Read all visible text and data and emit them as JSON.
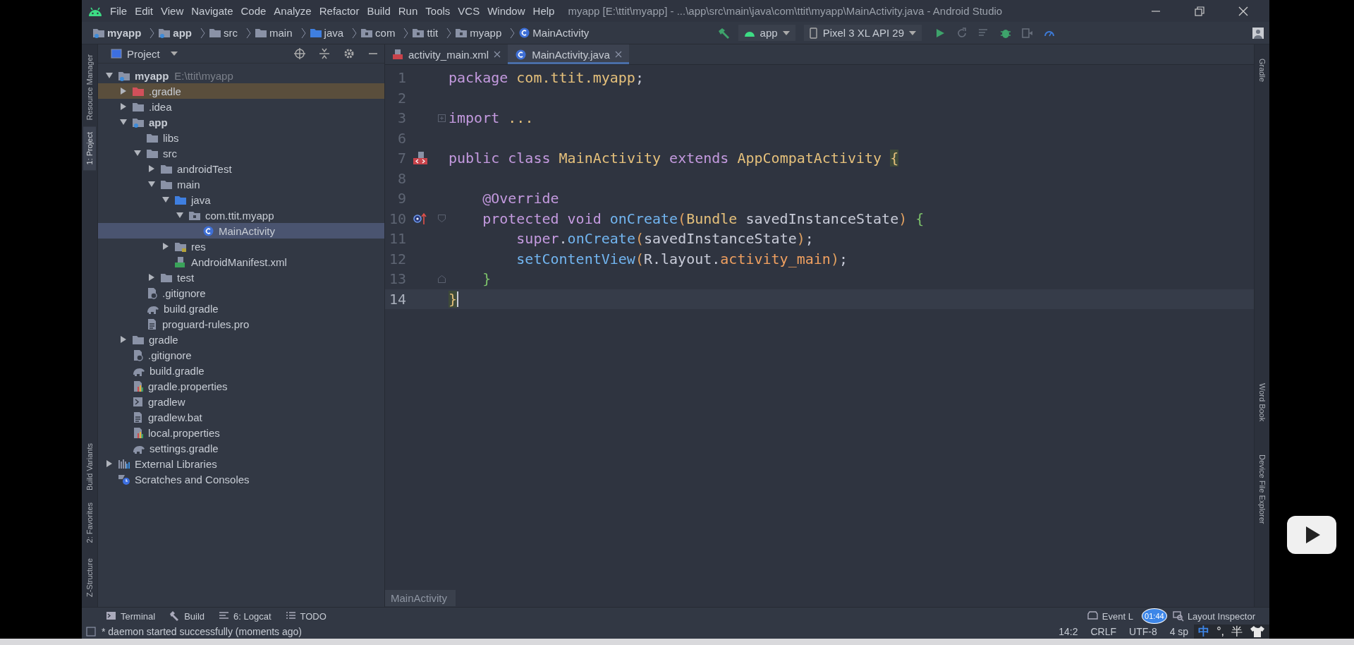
{
  "title_bar": {
    "menu": [
      "File",
      "Edit",
      "View",
      "Navigate",
      "Code",
      "Analyze",
      "Refactor",
      "Build",
      "Run",
      "Tools",
      "VCS",
      "Window",
      "Help"
    ],
    "title": "myapp [E:\\ttit\\myapp] - ...\\app\\src\\main\\java\\com\\ttit\\myapp\\MainActivity.java - Android Studio"
  },
  "nav_bar": {
    "breadcrumbs": [
      {
        "label": "myapp",
        "kind": "module"
      },
      {
        "label": "app",
        "kind": "module"
      },
      {
        "label": "src",
        "kind": "folder"
      },
      {
        "label": "main",
        "kind": "folder"
      },
      {
        "label": "java",
        "kind": "source"
      },
      {
        "label": "com",
        "kind": "package"
      },
      {
        "label": "ttit",
        "kind": "package"
      },
      {
        "label": "myapp",
        "kind": "package"
      },
      {
        "label": "MainActivity",
        "kind": "class"
      }
    ],
    "run_config": "app",
    "device": "Pixel 3 XL API 29"
  },
  "left_strip": [
    {
      "label": "Resource Manager",
      "selected": false
    },
    {
      "label": "1: Project",
      "selected": true
    },
    {
      "label": "Build Variants",
      "selected": false
    },
    {
      "label": "2: Favorites",
      "selected": false
    },
    {
      "label": "Z-Structure",
      "selected": false
    }
  ],
  "right_strip": [
    "Gradle",
    "Word Book",
    "Device File Explorer"
  ],
  "project_panel": {
    "title": "Project",
    "tree": [
      {
        "label": "myapp",
        "path": "E:\\ttit\\myapp",
        "kind": "module",
        "expanded": true,
        "selected": false,
        "marked": false,
        "children": [
          {
            "label": ".gradle",
            "kind": "cache",
            "expanded": false,
            "selected": false,
            "marked": true
          },
          {
            "label": ".idea",
            "kind": "folder",
            "expanded": false,
            "selected": false,
            "marked": false
          },
          {
            "label": "app",
            "kind": "module",
            "expanded": true,
            "selected": false,
            "marked": false,
            "children": [
              {
                "label": "libs",
                "kind": "folder",
                "selected": false,
                "marked": false
              },
              {
                "label": "src",
                "kind": "folder",
                "expanded": true,
                "selected": false,
                "marked": false,
                "children": [
                  {
                    "label": "androidTest",
                    "kind": "folder",
                    "expanded": false,
                    "selected": false,
                    "marked": false
                  },
                  {
                    "label": "main",
                    "kind": "folder",
                    "expanded": true,
                    "selected": false,
                    "marked": false,
                    "children": [
                      {
                        "label": "java",
                        "kind": "source",
                        "expanded": true,
                        "selected": false,
                        "marked": false,
                        "children": [
                          {
                            "label": "com.ttit.myapp",
                            "kind": "package",
                            "expanded": true,
                            "selected": false,
                            "marked": false,
                            "children": [
                              {
                                "label": "MainActivity",
                                "kind": "class",
                                "selected": true,
                                "marked": false
                              }
                            ]
                          }
                        ]
                      },
                      {
                        "label": "res",
                        "kind": "resources",
                        "expanded": false,
                        "selected": false,
                        "marked": false
                      },
                      {
                        "label": "AndroidManifest.xml",
                        "kind": "manifest",
                        "selected": false,
                        "marked": false
                      }
                    ]
                  },
                  {
                    "label": "test",
                    "kind": "folder",
                    "expanded": false,
                    "selected": false,
                    "marked": false
                  }
                ]
              },
              {
                "label": ".gitignore",
                "kind": "ignore",
                "selected": false,
                "marked": false
              },
              {
                "label": "build.gradle",
                "kind": "gradle",
                "selected": false,
                "marked": false
              },
              {
                "label": "proguard-rules.pro",
                "kind": "text",
                "selected": false,
                "marked": false
              }
            ]
          },
          {
            "label": "gradle",
            "kind": "folder",
            "expanded": false,
            "selected": false,
            "marked": false
          },
          {
            "label": ".gitignore",
            "kind": "ignore",
            "selected": false,
            "marked": false
          },
          {
            "label": "build.gradle",
            "kind": "gradle",
            "selected": false,
            "marked": false
          },
          {
            "label": "gradle.properties",
            "kind": "properties",
            "selected": false,
            "marked": false
          },
          {
            "label": "gradlew",
            "kind": "script",
            "selected": false,
            "marked": false
          },
          {
            "label": "gradlew.bat",
            "kind": "text",
            "selected": false,
            "marked": false
          },
          {
            "label": "local.properties",
            "kind": "properties",
            "selected": false,
            "marked": false
          },
          {
            "label": "settings.gradle",
            "kind": "gradle",
            "selected": false,
            "marked": false
          }
        ]
      },
      {
        "label": "External Libraries",
        "kind": "libraries",
        "expanded": false,
        "selected": false,
        "marked": false
      },
      {
        "label": "Scratches and Consoles",
        "kind": "scratches",
        "selected": false,
        "marked": false
      }
    ]
  },
  "editor": {
    "tabs": [
      {
        "label": "activity_main.xml",
        "kind": "layout",
        "selected": false
      },
      {
        "label": "MainActivity.java",
        "kind": "class",
        "selected": true
      }
    ],
    "lines": [
      {
        "number": "1",
        "current": false,
        "tokens": [
          {
            "text": "package ",
            "kind": "keyword"
          },
          {
            "text": "com.ttit.myapp",
            "kind": "type"
          },
          {
            "text": ";",
            "kind": "plain"
          }
        ]
      },
      {
        "number": "2",
        "current": false
      },
      {
        "number": "3",
        "current": false,
        "fold": {
          "kind": "collapsed"
        },
        "tokens": [
          {
            "text": "import ",
            "kind": "keyword"
          },
          {
            "text": "...",
            "kind": "folded"
          }
        ]
      },
      {
        "number": "6",
        "current": false
      },
      {
        "number": "7",
        "current": false,
        "gutter": {
          "kind": "layout"
        },
        "tokens": [
          {
            "text": "public class ",
            "kind": "keyword"
          },
          {
            "text": "MainActivity ",
            "kind": "type"
          },
          {
            "text": "extends ",
            "kind": "keyword"
          },
          {
            "text": "AppCompatActivity ",
            "kind": "type"
          },
          {
            "text": "{",
            "kind": "matched"
          }
        ]
      },
      {
        "number": "8",
        "current": false
      },
      {
        "number": "9",
        "current": false,
        "tokens": [
          {
            "text": "    @Override",
            "kind": "annotation"
          }
        ]
      },
      {
        "number": "10",
        "current": false,
        "gutter": {
          "kind": "override"
        },
        "fold": {
          "kind": "start"
        },
        "tokens": [
          {
            "text": "    protected void ",
            "kind": "keyword"
          },
          {
            "text": "onCreate",
            "kind": "method"
          },
          {
            "text": "(",
            "kind": "paren"
          },
          {
            "text": "Bundle ",
            "kind": "type"
          },
          {
            "text": "savedInstanceState",
            "kind": "plain"
          },
          {
            "text": ") ",
            "kind": "paren"
          },
          {
            "text": "{",
            "kind": "brace"
          }
        ]
      },
      {
        "number": "11",
        "current": false,
        "tokens": [
          {
            "text": "        super",
            "kind": "keyword"
          },
          {
            "text": ".",
            "kind": "plain"
          },
          {
            "text": "onCreate",
            "kind": "method"
          },
          {
            "text": "(",
            "kind": "paren"
          },
          {
            "text": "savedInstanceState",
            "kind": "plain"
          },
          {
            "text": ")",
            "kind": "paren"
          },
          {
            "text": ";",
            "kind": "plain"
          }
        ]
      },
      {
        "number": "12",
        "current": false,
        "tokens": [
          {
            "text": "        setContentView",
            "kind": "method"
          },
          {
            "text": "(",
            "kind": "paren"
          },
          {
            "text": "R.layout.",
            "kind": "plain"
          },
          {
            "text": "activity_main",
            "kind": "field"
          },
          {
            "text": ")",
            "kind": "paren"
          },
          {
            "text": ";",
            "kind": "plain"
          }
        ]
      },
      {
        "number": "13",
        "current": false,
        "fold": {
          "kind": "end"
        },
        "tokens": [
          {
            "text": "    }",
            "kind": "brace"
          }
        ]
      },
      {
        "number": "14",
        "current": true,
        "tokens": [
          {
            "text": "}",
            "kind": "matched"
          }
        ]
      }
    ],
    "breadcrumb": "MainActivity"
  },
  "bottom_tools": [
    {
      "label": "Terminal",
      "kind": "terminal"
    },
    {
      "label": "Build",
      "kind": "build"
    },
    {
      "label": "6: Logcat",
      "kind": "logcat"
    },
    {
      "label": "TODO",
      "kind": "todo"
    }
  ],
  "bottom_tools_right": [
    {
      "label": "Event L",
      "kind": "event"
    },
    {
      "label": "Layout Inspector",
      "kind": "inspector"
    }
  ],
  "status_bar": {
    "message": "* daemon started successfully (moments ago)",
    "items": [
      "14:2",
      "CRLF",
      "UTF-8",
      "4 sp"
    ]
  },
  "ime": [
    "中",
    "°,",
    "半"
  ],
  "timer": "01:44"
}
